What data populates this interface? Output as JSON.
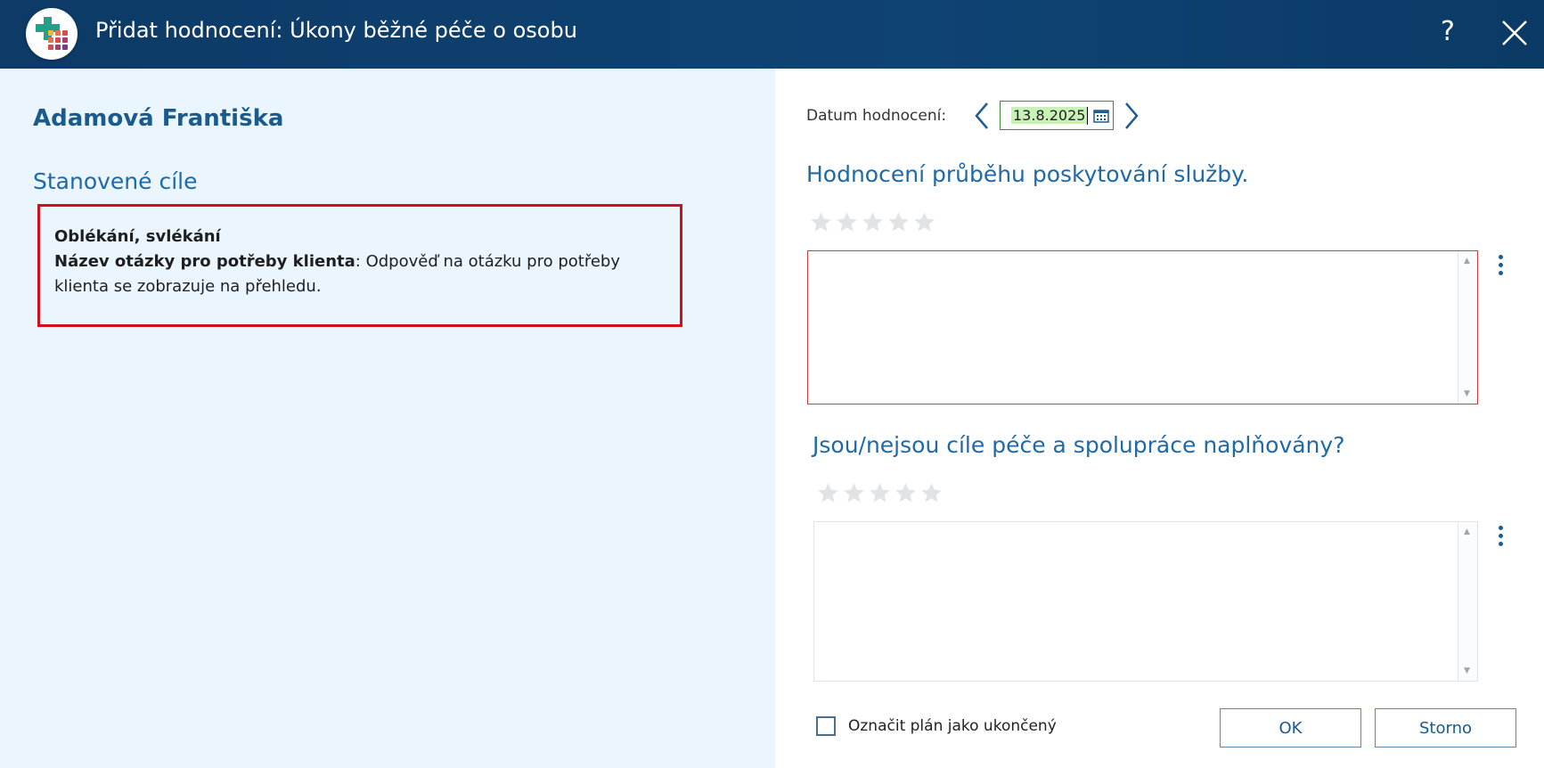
{
  "window": {
    "title": "Přidat hodnocení: Úkony běžné péče o osobu",
    "help_label": "?",
    "logo_icon": "app-logo-icon"
  },
  "left": {
    "client_name": "Adamová Františka",
    "goals_heading": "Stanovené cíle",
    "goal": {
      "title": "Oblékání, svlékání",
      "question_label": "Název otázky pro potřeby klienta",
      "separator": ":",
      "answer": " Odpověď na otázku pro potřeby klienta se zobrazuje na přehledu."
    }
  },
  "right": {
    "date_label": "Datum hodnocení:",
    "date_value": "13.8.2025",
    "question1": {
      "heading": "Hodnocení průběhu poskytování služby.",
      "rating": 0,
      "rating_max": 5,
      "text": ""
    },
    "question2": {
      "heading": "Jsou/nejsou cíle péče a spolupráce naplňovány?",
      "rating": 0,
      "rating_max": 5,
      "text": ""
    },
    "checkbox_label": "Označit plán jako ukončený",
    "checkbox_checked": false,
    "ok_label": "OK",
    "cancel_label": "Storno"
  },
  "colors": {
    "titlebar": "#0f4373",
    "accent": "#1f6aa6",
    "error_border": "#d1101a",
    "date_highlight": "#c7f1b5",
    "left_panel_bg": "#eaf5fd"
  }
}
